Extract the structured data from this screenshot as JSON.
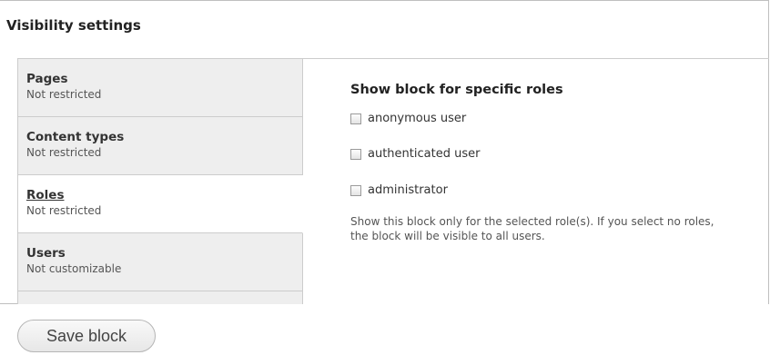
{
  "fieldset": {
    "title": "Visibility settings"
  },
  "vertical_tabs": [
    {
      "title": "Pages",
      "summary": "Not restricted",
      "active": false
    },
    {
      "title": "Content types",
      "summary": "Not restricted",
      "active": false
    },
    {
      "title": "Roles",
      "summary": "Not restricted",
      "active": true
    },
    {
      "title": "Users",
      "summary": "Not customizable",
      "active": false
    }
  ],
  "roles_pane": {
    "heading": "Show block for specific roles",
    "options": [
      {
        "label": "anonymous user",
        "checked": false
      },
      {
        "label": "authenticated user",
        "checked": false
      },
      {
        "label": "administrator",
        "checked": false
      }
    ],
    "description": "Show this block only for the selected role(s). If you select no roles, the block will be visible to all users."
  },
  "actions": {
    "save_label": "Save block"
  }
}
